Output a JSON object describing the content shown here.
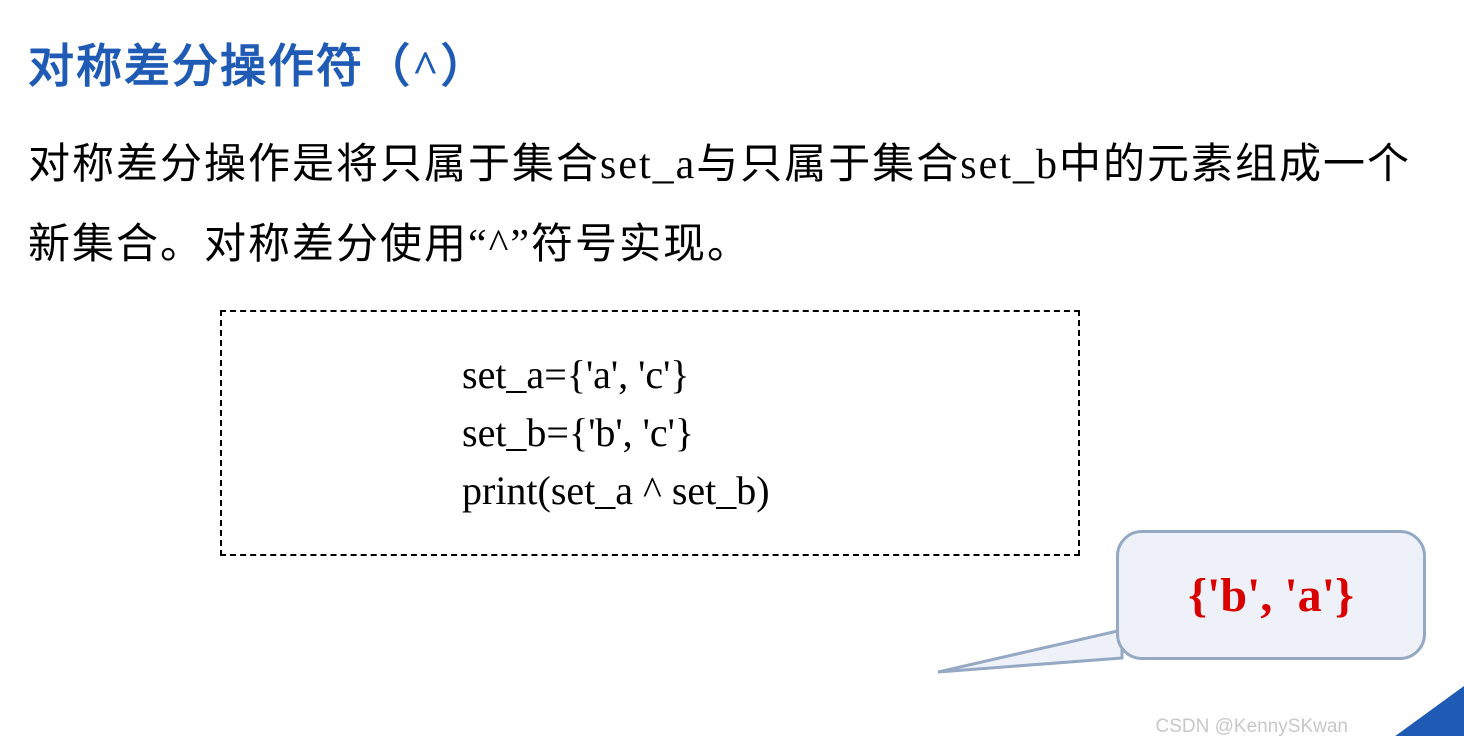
{
  "heading": "对称差分操作符（^）",
  "paragraph": "对称差分操作是将只属于集合set_a与只属于集合set_b中的元素组成一个新集合。对称差分使用“^”符号实现。",
  "code": {
    "line1": "set_a={'a', 'c'}",
    "line2": "set_b={'b', 'c'}",
    "line3": "print(set_a ^ set_b)"
  },
  "callout": "{'b', 'a'}",
  "watermark": "CSDN @KennySKwan"
}
